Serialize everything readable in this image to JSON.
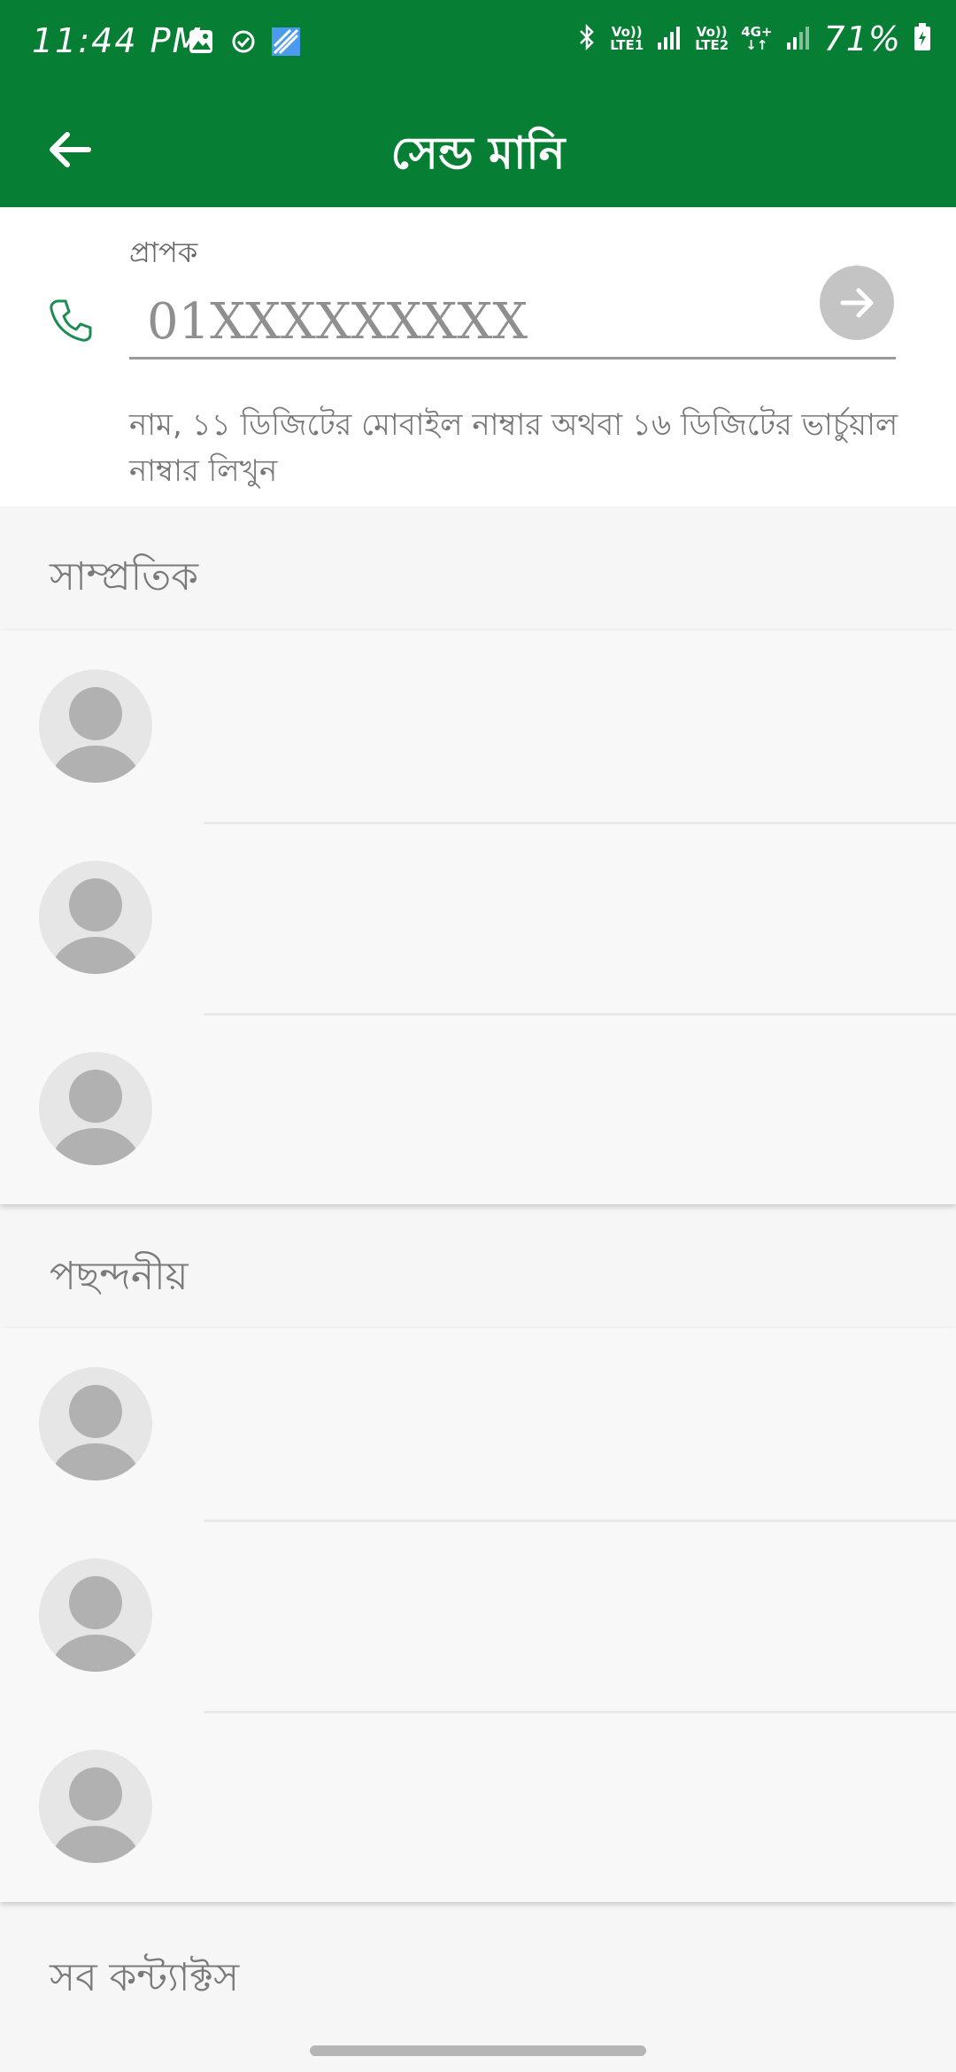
{
  "status_bar": {
    "time": "11:44 PM",
    "battery": "71%",
    "net1": {
      "top": "Vo))",
      "bottom": "LTE1"
    },
    "net2": {
      "top": "Vo))",
      "bottom": "LTE2"
    },
    "net3": "4G+",
    "icons": [
      "image-icon",
      "check-circle-icon",
      "app-icon",
      "bluetooth-icon",
      "signal-icon",
      "battery-icon"
    ]
  },
  "app_bar": {
    "title": "সেন্ড মানি",
    "back_icon": "arrow-left-icon"
  },
  "recipient": {
    "label": "প্রাপক",
    "placeholder": "01XXXXXXXXX",
    "value": "",
    "hint": "নাম, ১১ ডিজিটের মোবাইল নাম্বার অথবা ১৬ ডিজিটের ভার্চুয়াল নাম্বার লিখুন",
    "phone_icon": "phone-icon",
    "go_icon": "arrow-right-icon"
  },
  "sections": {
    "recent": {
      "title": "সাম্প্রতিক",
      "count": 3
    },
    "favorites": {
      "title": "পছন্দনীয়",
      "count": 3
    },
    "all_contacts": {
      "title": "সব কন্ট্যাক্টস"
    }
  },
  "colors": {
    "primary": "#067e34",
    "background": "#f6f6f6",
    "avatar": "#b1b1b1"
  }
}
